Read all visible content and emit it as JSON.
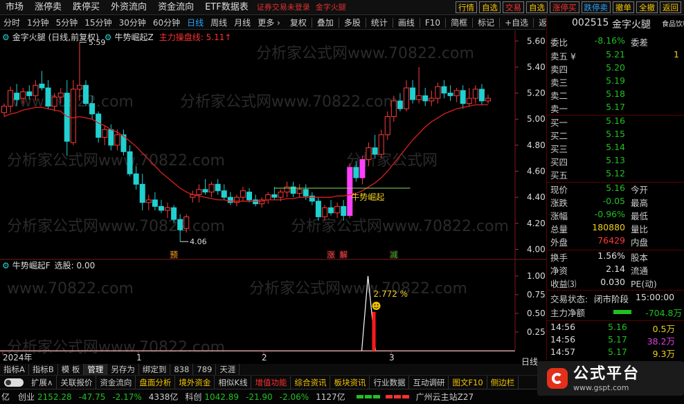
{
  "topbar": {
    "menus": [
      "市场",
      "涨停卖",
      "跌停买",
      "外资流向",
      "资金流向",
      "ETF数据表"
    ],
    "warning": "证券交易未登录",
    "stock_tag": "金字火腿",
    "right_buttons": [
      {
        "label": "行情",
        "color": "#f5c400"
      },
      {
        "label": "自选",
        "color": "#f5c400"
      },
      {
        "label": "交易",
        "color": "#ff3030"
      },
      {
        "label": "自选",
        "color": "#f5c400"
      },
      {
        "label": "涨停买",
        "color": "#ff3030"
      },
      {
        "label": "跌停卖",
        "color": "#29a3ff"
      },
      {
        "label": "撤单",
        "color": "#f5c400"
      },
      {
        "label": "全撤",
        "color": "#f5c400"
      },
      {
        "label": "返回",
        "color": "#f5c400"
      }
    ]
  },
  "toolbar": {
    "periods": [
      "分时",
      "1分钟",
      "5分钟",
      "15分钟",
      "30分钟",
      "60分钟",
      "日线",
      "周线",
      "月线",
      "更多 ›"
    ],
    "active_period": "日线",
    "tools": [
      "复权",
      "叠加",
      "多股",
      "统计",
      "画线",
      "F10",
      "简框",
      "标记",
      "+自选",
      "返回"
    ]
  },
  "main_legend": {
    "title": "金字火腿 (日线,前复权)",
    "indicator": "牛势崛起Z",
    "line_label": "主力操盘线: 5.11↑"
  },
  "sub_legend": {
    "title": "牛势崛起F",
    "value_label": "选股: 0.00"
  },
  "annotations": {
    "high": "5.59",
    "low": "4.06",
    "signal_text": "牛势崛起",
    "pct_label": "2.772 %",
    "smile_icon": "smile-icon",
    "markers": [
      {
        "text": "预",
        "color": "#e0a000"
      },
      {
        "text": "涨",
        "color": "#ff4040"
      },
      {
        "text": "解",
        "color": "#ff4040"
      },
      {
        "text": "减",
        "color": "#20c020"
      }
    ]
  },
  "x_axis_labels": [
    "2024年",
    "1",
    "2",
    "3"
  ],
  "x_axis_period": "日线",
  "chart_data": {
    "type": "candlestick",
    "ylim": [
      3.96,
      5.66
    ],
    "yticks": [
      "5.60",
      "5.40",
      "5.20",
      "5.00",
      "4.80",
      "4.60",
      "4.40",
      "4.20",
      "4.00"
    ],
    "candles": [
      {
        "o": 5.05,
        "h": 5.12,
        "l": 5.02,
        "c": 5.1
      },
      {
        "o": 5.1,
        "h": 5.25,
        "l": 5.05,
        "c": 5.22
      },
      {
        "o": 5.2,
        "h": 5.27,
        "l": 5.1,
        "c": 5.15
      },
      {
        "o": 5.16,
        "h": 5.24,
        "l": 5.12,
        "c": 5.21
      },
      {
        "o": 5.21,
        "h": 5.26,
        "l": 5.15,
        "c": 5.18
      },
      {
        "o": 5.18,
        "h": 5.3,
        "l": 5.14,
        "c": 5.26
      },
      {
        "o": 5.27,
        "h": 5.37,
        "l": 5.22,
        "c": 5.24
      },
      {
        "o": 5.24,
        "h": 5.3,
        "l": 5.08,
        "c": 5.1
      },
      {
        "o": 5.1,
        "h": 5.2,
        "l": 5.06,
        "c": 5.17
      },
      {
        "o": 5.17,
        "h": 5.24,
        "l": 5.12,
        "c": 5.2
      },
      {
        "o": 5.2,
        "h": 5.3,
        "l": 4.72,
        "c": 4.83
      },
      {
        "o": 4.82,
        "h": 5.3,
        "l": 4.8,
        "c": 5.23
      },
      {
        "o": 5.23,
        "h": 5.59,
        "l": 5.14,
        "c": 5.26
      },
      {
        "o": 5.26,
        "h": 5.3,
        "l": 5.1,
        "c": 5.12
      },
      {
        "o": 5.12,
        "h": 5.18,
        "l": 5.0,
        "c": 5.04
      },
      {
        "o": 5.04,
        "h": 5.06,
        "l": 4.82,
        "c": 4.86
      },
      {
        "o": 4.86,
        "h": 4.95,
        "l": 4.8,
        "c": 4.92
      },
      {
        "o": 4.92,
        "h": 4.96,
        "l": 4.76,
        "c": 4.8
      },
      {
        "o": 4.8,
        "h": 4.92,
        "l": 4.76,
        "c": 4.88
      },
      {
        "o": 4.88,
        "h": 4.92,
        "l": 4.72,
        "c": 4.75
      },
      {
        "o": 4.75,
        "h": 4.8,
        "l": 4.56,
        "c": 4.58
      },
      {
        "o": 4.58,
        "h": 4.64,
        "l": 4.46,
        "c": 4.5
      },
      {
        "o": 4.5,
        "h": 4.58,
        "l": 4.3,
        "c": 4.36
      },
      {
        "o": 4.36,
        "h": 4.42,
        "l": 4.3,
        "c": 4.38
      },
      {
        "o": 4.38,
        "h": 4.44,
        "l": 4.3,
        "c": 4.33
      },
      {
        "o": 4.33,
        "h": 4.38,
        "l": 4.28,
        "c": 4.3
      },
      {
        "o": 4.3,
        "h": 4.36,
        "l": 4.24,
        "c": 4.32
      },
      {
        "o": 4.32,
        "h": 4.34,
        "l": 4.2,
        "c": 4.23
      },
      {
        "o": 4.23,
        "h": 4.27,
        "l": 4.06,
        "c": 4.15
      },
      {
        "o": 4.16,
        "h": 4.27,
        "l": 4.13,
        "c": 4.25
      },
      {
        "o": 4.4,
        "h": 4.45,
        "l": 4.36,
        "c": 4.42
      },
      {
        "o": 4.42,
        "h": 4.5,
        "l": 4.36,
        "c": 4.46
      },
      {
        "o": 4.46,
        "h": 4.54,
        "l": 4.42,
        "c": 4.44
      },
      {
        "o": 4.44,
        "h": 4.52,
        "l": 4.4,
        "c": 4.5
      },
      {
        "o": 4.5,
        "h": 4.54,
        "l": 4.42,
        "c": 4.45
      },
      {
        "o": 4.45,
        "h": 4.5,
        "l": 4.38,
        "c": 4.4
      },
      {
        "o": 4.4,
        "h": 4.44,
        "l": 4.34,
        "c": 4.36
      },
      {
        "o": 4.36,
        "h": 4.42,
        "l": 4.33,
        "c": 4.4
      },
      {
        "o": 4.4,
        "h": 4.48,
        "l": 4.37,
        "c": 4.45
      },
      {
        "o": 4.44,
        "h": 4.47,
        "l": 4.36,
        "c": 4.38
      },
      {
        "o": 4.38,
        "h": 4.42,
        "l": 4.33,
        "c": 4.35
      },
      {
        "o": 4.35,
        "h": 4.4,
        "l": 4.32,
        "c": 4.38
      },
      {
        "o": 4.38,
        "h": 4.44,
        "l": 4.35,
        "c": 4.42
      },
      {
        "o": 4.42,
        "h": 4.48,
        "l": 4.38,
        "c": 4.4
      },
      {
        "o": 4.4,
        "h": 4.46,
        "l": 4.37,
        "c": 4.44
      },
      {
        "o": 4.44,
        "h": 4.52,
        "l": 4.4,
        "c": 4.48
      },
      {
        "o": 4.48,
        "h": 4.52,
        "l": 4.4,
        "c": 4.43
      },
      {
        "o": 4.43,
        "h": 4.5,
        "l": 4.4,
        "c": 4.46
      },
      {
        "o": 4.46,
        "h": 4.5,
        "l": 4.38,
        "c": 4.41
      },
      {
        "o": 4.41,
        "h": 4.44,
        "l": 4.34,
        "c": 4.37
      },
      {
        "o": 4.37,
        "h": 4.4,
        "l": 4.22,
        "c": 4.25
      },
      {
        "o": 4.25,
        "h": 4.34,
        "l": 4.22,
        "c": 4.32
      },
      {
        "o": 4.32,
        "h": 4.38,
        "l": 4.26,
        "c": 4.28
      },
      {
        "o": 4.28,
        "h": 4.36,
        "l": 4.24,
        "c": 4.33
      },
      {
        "o": 4.33,
        "h": 4.38,
        "l": 4.22,
        "c": 4.26
      },
      {
        "o": 4.26,
        "h": 4.66,
        "l": 4.24,
        "c": 4.63
      },
      {
        "o": 4.63,
        "h": 4.68,
        "l": 4.52,
        "c": 4.55
      },
      {
        "o": 4.55,
        "h": 4.72,
        "l": 4.5,
        "c": 4.69
      },
      {
        "o": 4.69,
        "h": 4.82,
        "l": 4.64,
        "c": 4.78
      },
      {
        "o": 4.78,
        "h": 4.88,
        "l": 4.7,
        "c": 4.73
      },
      {
        "o": 4.73,
        "h": 4.92,
        "l": 4.7,
        "c": 4.88
      },
      {
        "o": 4.88,
        "h": 5.06,
        "l": 4.84,
        "c": 5.02
      },
      {
        "o": 5.02,
        "h": 5.18,
        "l": 4.98,
        "c": 5.14
      },
      {
        "o": 5.14,
        "h": 5.2,
        "l": 5.06,
        "c": 5.08
      },
      {
        "o": 5.08,
        "h": 5.3,
        "l": 5.06,
        "c": 5.24
      },
      {
        "o": 5.24,
        "h": 5.3,
        "l": 5.12,
        "c": 5.15
      },
      {
        "o": 5.15,
        "h": 5.4,
        "l": 5.12,
        "c": 5.18
      },
      {
        "o": 5.18,
        "h": 5.24,
        "l": 5.1,
        "c": 5.14
      },
      {
        "o": 5.14,
        "h": 5.22,
        "l": 5.1,
        "c": 5.16
      },
      {
        "o": 5.16,
        "h": 5.28,
        "l": 5.12,
        "c": 5.25
      },
      {
        "o": 5.25,
        "h": 5.3,
        "l": 5.16,
        "c": 5.2
      },
      {
        "o": 5.2,
        "h": 5.26,
        "l": 5.14,
        "c": 5.18
      },
      {
        "o": 5.18,
        "h": 5.24,
        "l": 5.13,
        "c": 5.22
      },
      {
        "o": 5.22,
        "h": 5.26,
        "l": 5.08,
        "c": 5.12
      },
      {
        "o": 5.12,
        "h": 5.24,
        "l": 5.1,
        "c": 5.16
      },
      {
        "o": 5.16,
        "h": 5.26,
        "l": 5.12,
        "c": 5.23
      },
      {
        "o": 5.23,
        "h": 5.27,
        "l": 5.11,
        "c": 5.14
      },
      {
        "o": 5.14,
        "h": 5.19,
        "l": 5.12,
        "c": 5.16
      }
    ],
    "ma": [
      5.02,
      5.04,
      5.05,
      5.07,
      5.08,
      5.09,
      5.09,
      5.08,
      5.07,
      5.06,
      5.02,
      5.01,
      5.02,
      5.01,
      5.0,
      4.97,
      4.95,
      4.92,
      4.9,
      4.87,
      4.83,
      4.79,
      4.74,
      4.69,
      4.64,
      4.59,
      4.55,
      4.51,
      4.47,
      4.44,
      4.42,
      4.41,
      4.4,
      4.39,
      4.38,
      4.38,
      4.37,
      4.37,
      4.37,
      4.37,
      4.37,
      4.37,
      4.38,
      4.38,
      4.38,
      4.39,
      4.39,
      4.4,
      4.4,
      4.4,
      4.4,
      4.4,
      4.4,
      4.41,
      4.41,
      4.42,
      4.43,
      4.45,
      4.48,
      4.51,
      4.55,
      4.6,
      4.66,
      4.72,
      4.78,
      4.84,
      4.89,
      4.94,
      4.98,
      5.01,
      5.04,
      5.06,
      5.08,
      5.09,
      5.1,
      5.11,
      5.11,
      5.11
    ],
    "sub_indicator": {
      "ylim": [
        0,
        1.12
      ],
      "yticks": [
        "1.00",
        "0.75",
        "0.50",
        "0.25"
      ],
      "spike_index": 58,
      "spike_value": 1.0,
      "bar_value": 0.52
    }
  },
  "right_panel": {
    "code": "002515",
    "name": "金字火腿",
    "side_tag": "食品饮料",
    "weibi_label": "委比",
    "weibi": "-8.16%",
    "weicha_label": "委差",
    "sell": [
      {
        "label": "卖五 ¥",
        "price": "5.21",
        "vol": "1"
      },
      {
        "label": "卖四",
        "price": "5.20",
        "vol": ""
      },
      {
        "label": "卖三",
        "price": "5.19",
        "vol": ""
      },
      {
        "label": "卖二",
        "price": "5.18",
        "vol": ""
      },
      {
        "label": "卖一",
        "price": "5.17",
        "vol": ""
      }
    ],
    "buy": [
      {
        "label": "买一",
        "price": "5.16",
        "vol": ""
      },
      {
        "label": "买二",
        "price": "5.15",
        "vol": ""
      },
      {
        "label": "买三",
        "price": "5.14",
        "vol": ""
      },
      {
        "label": "买四",
        "price": "5.13",
        "vol": ""
      },
      {
        "label": "买五",
        "price": "5.12",
        "vol": ""
      }
    ],
    "stats": [
      {
        "l1": "现价",
        "v1": "5.16",
        "c1": "g",
        "l2": "今开"
      },
      {
        "l1": "涨跌",
        "v1": "-0.05",
        "c1": "g",
        "l2": "最高"
      },
      {
        "l1": "涨幅",
        "v1": "-0.96%",
        "c1": "g",
        "l2": "最低"
      },
      {
        "l1": "总量",
        "v1": "180880",
        "c1": "y",
        "l2": "量比"
      },
      {
        "l1": "外盘",
        "v1": "76429",
        "c1": "r",
        "l2": "内盘"
      },
      {
        "l1": "换手",
        "v1": "1.56%",
        "c1": "w",
        "l2": "股本"
      },
      {
        "l1": "净资",
        "v1": "2.14",
        "c1": "w",
        "l2": "流通"
      },
      {
        "l1": "收益⑶",
        "v1": "0.030",
        "c1": "w",
        "l2": "PE(动)"
      }
    ],
    "trade_status_label": "交易状态:",
    "trade_status": "闭市阶段",
    "trade_time": "15:00:00",
    "net_label": "主力净额",
    "net_value": "-704.8万",
    "ticks": [
      {
        "time": "14:56",
        "price": "5.16",
        "vol": "0.5万",
        "vc": "y"
      },
      {
        "time": "14:56",
        "price": "5.17",
        "vol": "38.2万",
        "vc": "m"
      },
      {
        "time": "14:57",
        "price": "5.17",
        "vol": "9.3万",
        "vc": "y"
      }
    ]
  },
  "tabs": [
    "指标A",
    "指标B",
    "模 板",
    "管理",
    "另存为",
    "绑定到",
    "838",
    "789",
    "天涯"
  ],
  "active_tab": "管理",
  "funcbar": {
    "expand": "扩展∧",
    "items": [
      {
        "label": "关联报价",
        "color": "#cccccc"
      },
      {
        "label": "资金流向",
        "color": "#cccccc"
      },
      {
        "label": "盘面分析",
        "color": "#f5c400"
      },
      {
        "label": "境外资金",
        "color": "#f5c400"
      },
      {
        "label": "相似K线",
        "color": "#cccccc"
      },
      {
        "label": "增值功能",
        "color": "#ff3030"
      },
      {
        "label": "综合资讯",
        "color": "#f5c400"
      },
      {
        "label": "板块资讯",
        "color": "#f5c400"
      },
      {
        "label": "行业数据",
        "color": "#cccccc"
      },
      {
        "label": "互动调研",
        "color": "#cccccc"
      },
      {
        "label": "图文F10",
        "color": "#f5c400"
      },
      {
        "label": "侧边栏",
        "color": "#f5c400"
      }
    ]
  },
  "status": {
    "left_amount": "亿",
    "idx1_name": "创业",
    "idx1_val": "2152.28",
    "idx1_chg": "-47.75",
    "idx1_pct": "-2.17%",
    "idx1_amt": "4338亿",
    "idx2_name": "科创",
    "idx2_val": "1042.89",
    "idx2_chg": "-21.90",
    "idx2_pct": "-2.06%",
    "idx2_amt": "1127亿",
    "site": "广州云主站Z27"
  },
  "brand": {
    "name": "公式平台",
    "url": "www.gspt.com"
  }
}
